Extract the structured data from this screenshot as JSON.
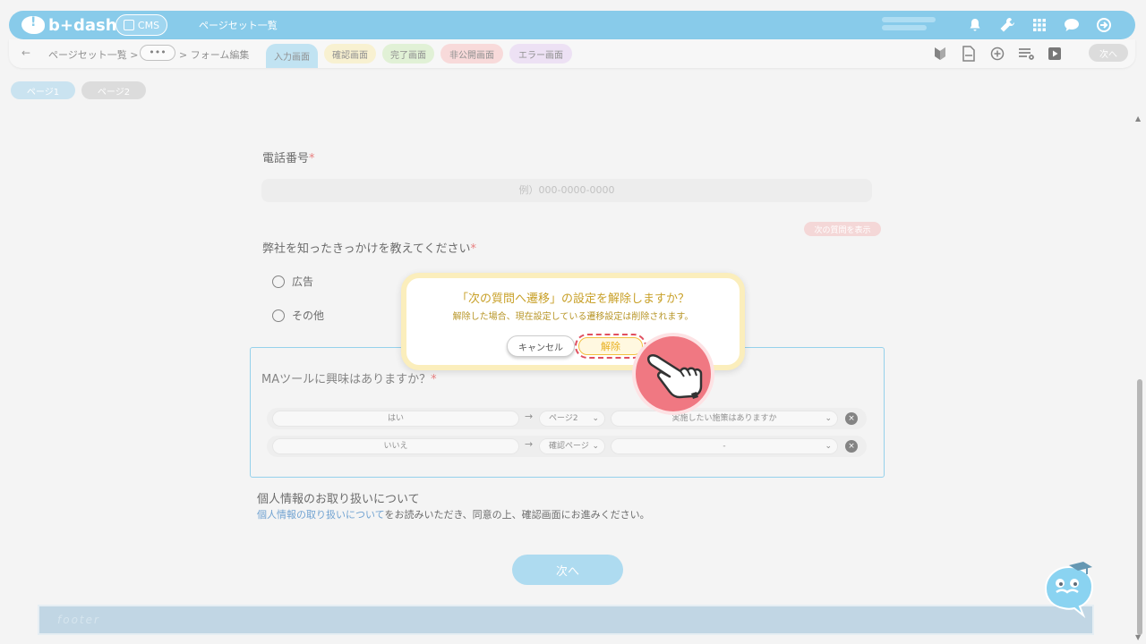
{
  "appbar": {
    "logo": "b+dash",
    "cms_label": "CMS",
    "title": "ページセット一覧"
  },
  "toolbar": {
    "back": "←",
    "crumb_pagesets": "ページセット一覧 >",
    "crumb_more": "•••",
    "crumb_form_edit": "> フォーム編集",
    "tabs": [
      {
        "label": "入力画面",
        "color": "#a9d8ee"
      },
      {
        "label": "確認画面",
        "color": "#f6ecc0"
      },
      {
        "label": "完了画面",
        "color": "#d6ecc6"
      },
      {
        "label": "非公開画面",
        "color": "#f6cccc"
      },
      {
        "label": "エラー画面",
        "color": "#e6d6f0"
      }
    ],
    "next_label": "次へ"
  },
  "page_tabs": [
    {
      "label": "ページ1",
      "color": "#b6d8ea"
    },
    {
      "label": "ページ2",
      "color": "#cfcfcf"
    }
  ],
  "form": {
    "phone_label": "電話番号",
    "required_mark": "*",
    "phone_placeholder": "例）000-0000-0000",
    "show_next_label": "次の質問を表示",
    "source_label": "弊社を知ったきっかけを教えてください",
    "options": [
      "広告",
      "その他"
    ],
    "ma_label": "MAツールに興味はありますか？",
    "conditions": [
      {
        "value": "はい",
        "arrow": "→",
        "target": "ページ2",
        "question": "実施したい施策はありますか"
      },
      {
        "value": "いいえ",
        "arrow": "→",
        "target": "確認ページ",
        "question": "-"
      }
    ],
    "privacy_title": "個人情報のお取り扱いについて",
    "privacy_link": "個人情報の取り扱いについて",
    "privacy_rest": "をお読みいただき、同意の上、確認画面にお進みください。",
    "next_label": "次へ"
  },
  "footer": {
    "text": "footer"
  },
  "dialog": {
    "title": "「次の質問へ遷移」の設定を解除しますか？",
    "subtitle": "解除した場合、現在設定している遷移設定は削除されます。",
    "cancel_label": "キャンセル",
    "release_label": "解除"
  },
  "colors": {
    "brand": "#5ab8e2",
    "accent_yellow": "#e8b020",
    "highlight_red": "#e05060"
  }
}
